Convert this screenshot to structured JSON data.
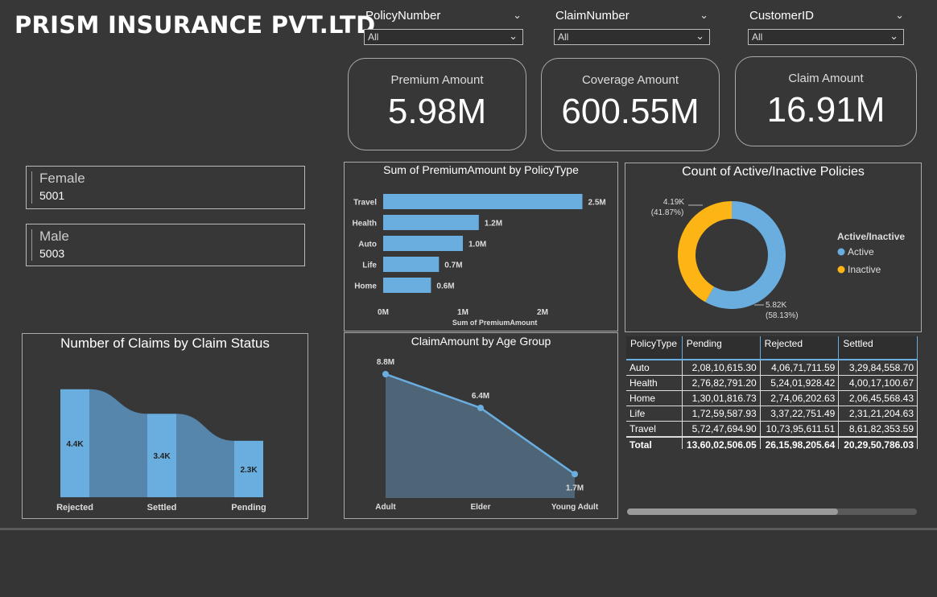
{
  "header": {
    "title": "PRISM INSURANCE PVT.LTD"
  },
  "slicers": [
    {
      "label": "PolicyNumber",
      "value": "All"
    },
    {
      "label": "ClaimNumber",
      "value": "All"
    },
    {
      "label": "CustomerID",
      "value": "All"
    }
  ],
  "kpis": [
    {
      "label": "Premium Amount",
      "value": "5.98M"
    },
    {
      "label": "Coverage Amount",
      "value": "600.55M"
    },
    {
      "label": "Claim Amount",
      "value": "16.91M"
    }
  ],
  "gender": [
    {
      "label": "Female",
      "value": "5001"
    },
    {
      "label": "Male",
      "value": "5003"
    }
  ],
  "colors": {
    "bar": "#6aaee0",
    "active": "#6aaee0",
    "inactive": "#fdb515",
    "area": "#4e6477",
    "bg": "#373737"
  },
  "chart_data": [
    {
      "type": "bar",
      "title": "Sum of PremiumAmount by PolicyType",
      "xlabel": "Sum of PremiumAmount",
      "ylabel": "",
      "categories": [
        "Travel",
        "Health",
        "Auto",
        "Life",
        "Home"
      ],
      "values": [
        2.5,
        1.2,
        1.0,
        0.7,
        0.6
      ],
      "data_labels": [
        "2.5M",
        "1.2M",
        "1.0M",
        "0.7M",
        "0.6M"
      ],
      "xticks": [
        "0M",
        "1M",
        "2M"
      ],
      "xlim": [
        0,
        2.5
      ]
    },
    {
      "type": "pie",
      "title": "Count of Active/Inactive Policies",
      "legend_title": "Active/Inactive",
      "legend_position": "right",
      "slices": [
        {
          "name": "Active",
          "value": 5.82,
          "label": "5.82K",
          "pct": "(58.13%)",
          "color": "#6aaee0"
        },
        {
          "name": "Inactive",
          "value": 4.19,
          "label": "4.19K",
          "pct": "(41.87%)",
          "color": "#fdb515"
        }
      ]
    },
    {
      "type": "bar",
      "title": "Number of Claims by Claim Status",
      "categories": [
        "Rejected",
        "Settled",
        "Pending"
      ],
      "values": [
        4.4,
        3.4,
        2.3
      ],
      "data_labels": [
        "4.4K",
        "3.4K",
        "2.3K"
      ]
    },
    {
      "type": "area",
      "title": "ClaimAmount by Age Group",
      "categories": [
        "Adult",
        "Elder",
        "Young Adult"
      ],
      "values": [
        8.8,
        6.4,
        1.7
      ],
      "data_labels": [
        "8.8M",
        "6.4M",
        "1.7M"
      ]
    },
    {
      "type": "table",
      "columns": [
        "PolicyType",
        "Pending",
        "Rejected",
        "Settled"
      ],
      "rows": [
        [
          "Auto",
          "2,08,10,615.30",
          "4,06,71,711.59",
          "3,29,84,558.70"
        ],
        [
          "Health",
          "2,76,82,791.20",
          "5,24,01,928.42",
          "4,00,17,100.67"
        ],
        [
          "Home",
          "1,30,01,816.73",
          "2,74,06,202.63",
          "2,06,45,568.43"
        ],
        [
          "Life",
          "1,72,59,587.93",
          "3,37,22,751.49",
          "2,31,21,204.63"
        ],
        [
          "Travel",
          "5,72,47,694.90",
          "10,73,95,611.51",
          "8,61,82,353.59"
        ]
      ],
      "total": [
        "Total",
        "13,60,02,506.05",
        "26,15,98,205.64",
        "20,29,50,786.03"
      ]
    }
  ]
}
